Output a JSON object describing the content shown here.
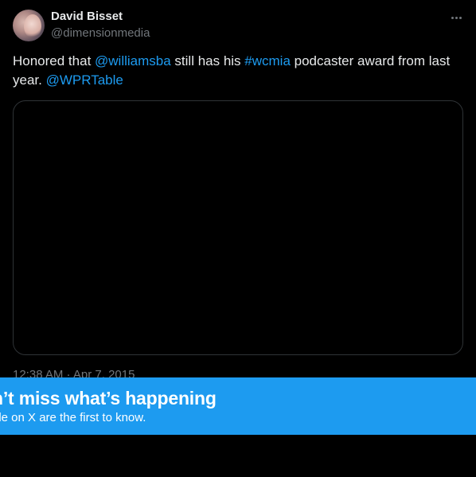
{
  "tweet": {
    "display_name": "David Bisset",
    "handle": "@dimensionmedia",
    "text_parts": {
      "p1": "Honored that ",
      "mention1": "@williamsba",
      "p2": " still has his ",
      "hashtag": "#wcmia",
      "p3": " podcaster award from last year. ",
      "mention2": "@WPRTable"
    },
    "timestamp": "12:38 AM · Apr 7, 2015",
    "more_icon": "more-horizontal-icon"
  },
  "banner": {
    "title": "n’t miss what’s happening",
    "subtitle": "ple on X are the first to know."
  },
  "colors": {
    "background": "#000000",
    "text": "#e7e9ea",
    "secondary": "#71767b",
    "link": "#1d9bf0",
    "banner": "#1d9bf0"
  }
}
